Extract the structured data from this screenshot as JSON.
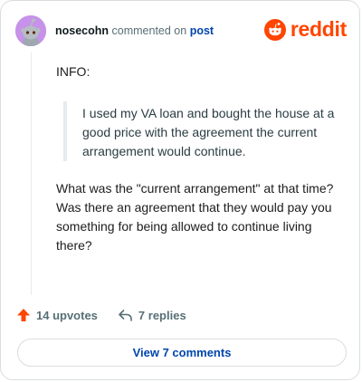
{
  "comment": {
    "username": "nosecohn",
    "commented_on_text": "commented on",
    "post_link_text": "post",
    "body": {
      "intro": "INFO:",
      "quote": "I used my VA loan and bought the house at a good price with the agreement the current arrangement would continue.",
      "text": "What was the \"current arrangement\" at that time? Was there an agreement that they would pay you something for being allowed to continue living there?"
    }
  },
  "brand": {
    "logo_text": "reddit",
    "logo_color": "#ff4500",
    "link_color": "#0045ac",
    "avatar_color": "#c792e9"
  },
  "actions": {
    "upvotes_label": "14 upvotes",
    "replies_label": "7 replies"
  },
  "footer": {
    "view_comments_label": "View 7 comments"
  },
  "icons": [
    "snoo-avatar-icon",
    "reddit-logo-icon",
    "upvote-arrow-icon",
    "reply-arrow-icon"
  ]
}
